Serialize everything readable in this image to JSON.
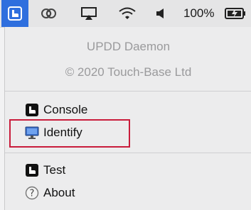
{
  "menubar": {
    "app_icon": "updd-app-icon",
    "icons": [
      "creative-cloud-icon",
      "airplay-icon",
      "wifi-icon",
      "volume-icon"
    ],
    "battery_percent": "100%",
    "battery_icon": "battery-charging-icon"
  },
  "menu": {
    "app_name": "UPDD Daemon",
    "copyright": "© 2020 Touch-Base Ltd",
    "items": [
      {
        "label": "Console",
        "icon": "updd-console-icon"
      },
      {
        "label": "Identify",
        "icon": "monitor-icon"
      },
      {
        "label": "Test",
        "icon": "updd-test-icon"
      },
      {
        "label": "About",
        "icon": "help-icon"
      }
    ]
  },
  "annotation": {
    "highlight_color": "#c91c3b",
    "target": "Identify"
  }
}
